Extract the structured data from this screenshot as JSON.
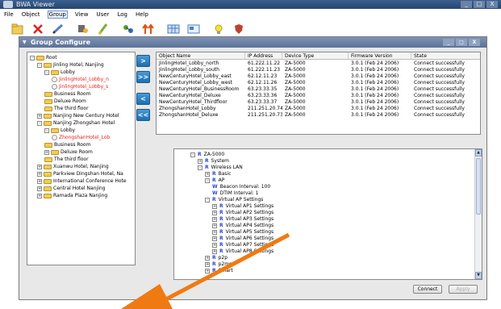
{
  "app": {
    "title": "BWA Viewer"
  },
  "window_controls": [
    "_",
    "□",
    "X"
  ],
  "menu": [
    "File",
    "Object",
    "Group",
    "View",
    "User",
    "Log",
    "Help"
  ],
  "menu_selected": "Group",
  "toolbar_icons": [
    "open-icon",
    "delete-icon",
    "edit-icon",
    "config-icon",
    "pen-icon",
    "link-icon",
    "upgrade-icon",
    "table-icon",
    "terminal-icon",
    "bulb-icon",
    "shield-icon"
  ],
  "panel": {
    "title": "Group Configure",
    "controls": [
      "_",
      "□",
      "X"
    ]
  },
  "left_tree": [
    {
      "label": "Root",
      "level": 0,
      "type": "folder",
      "expander": "-",
      "red": false
    },
    {
      "label": "Jinling Hotel, Nanjing",
      "level": 1,
      "type": "folder",
      "expander": "-",
      "red": false
    },
    {
      "label": "Lobby",
      "level": 2,
      "type": "folder",
      "expander": "-",
      "red": false
    },
    {
      "label": "JinlingHotel_Lobby_n",
      "level": 3,
      "type": "device",
      "expander": "",
      "red": true
    },
    {
      "label": "JinlingHotel_Lobby_s",
      "level": 3,
      "type": "device",
      "expander": "",
      "red": true
    },
    {
      "label": "Business Room",
      "level": 2,
      "type": "folder",
      "expander": "",
      "red": false
    },
    {
      "label": "Deluxe Room",
      "level": 2,
      "type": "folder",
      "expander": "",
      "red": false
    },
    {
      "label": "The third floor",
      "level": 2,
      "type": "folder",
      "expander": "",
      "red": false
    },
    {
      "label": "Nanjing New Century Hotel",
      "level": 1,
      "type": "folder",
      "expander": "+",
      "red": false
    },
    {
      "label": "Nanjing Zhongshan Hotel",
      "level": 1,
      "type": "folder",
      "expander": "-",
      "red": false
    },
    {
      "label": "Lobby",
      "level": 2,
      "type": "folder",
      "expander": "-",
      "red": false
    },
    {
      "label": "ZhongshanHotel_Lob",
      "level": 3,
      "type": "device",
      "expander": "",
      "red": true
    },
    {
      "label": "Business Room",
      "level": 2,
      "type": "folder",
      "expander": "",
      "red": false
    },
    {
      "label": "Deluxe Room",
      "level": 2,
      "type": "folder",
      "expander": "+",
      "red": false
    },
    {
      "label": "The third floor",
      "level": 2,
      "type": "folder",
      "expander": "",
      "red": false
    },
    {
      "label": "Xuanwu Hotel, Nanjing",
      "level": 1,
      "type": "folder",
      "expander": "+",
      "red": false
    },
    {
      "label": "Parkview Dingshan Hotel, Na",
      "level": 1,
      "type": "folder",
      "expander": "+",
      "red": false
    },
    {
      "label": "International Conference Hote",
      "level": 1,
      "type": "folder",
      "expander": "+",
      "red": false
    },
    {
      "label": "Central Hotel Nanjing",
      "level": 1,
      "type": "folder",
      "expander": "+",
      "red": false
    },
    {
      "label": "Ramada Plaza Nanjing",
      "level": 1,
      "type": "folder",
      "expander": "+",
      "red": false
    }
  ],
  "mid_buttons": [
    ">",
    ">>",
    "<",
    "<<"
  ],
  "table": {
    "columns": [
      "Object Name",
      "IP Address",
      "Device Type",
      "Firmware Version",
      "State"
    ],
    "rows": [
      [
        "JinlingHotel_Lobby_north",
        "61.222.11.22",
        "ZA-5000",
        "3.0.1 (Feb 24 2006)",
        "Connect successfully"
      ],
      [
        "JinlingHotel_Lobby_south",
        "61.222.11.23",
        "ZA-5000",
        "3.0.1 (Feb 24 2006)",
        "Connect successfully"
      ],
      [
        "NewCenturyHotel_Lobby_east",
        "62.12.11.23",
        "ZA-5000",
        "3.0.1 (Feb 24 2006)",
        "Connect successfully"
      ],
      [
        "NewCenturyHotel_Lobby_west",
        "62.12.11.26",
        "ZA-5000",
        "3.0.1 (Feb 24 2006)",
        "Connect successfully"
      ],
      [
        "NewCenturyHotel_BusinessRoom",
        "63.23.33.35",
        "ZA-5000",
        "3.0.1 (Feb 24 2006)",
        "Connect successfully"
      ],
      [
        "NewCenturyHotel_Deluxe",
        "63.23.33.36",
        "ZA-5000",
        "3.0.1 (Feb 24 2006)",
        "Connect successfully"
      ],
      [
        "NewCenturyHotel_Thirdfloor",
        "63.23.33.37",
        "ZA-5000",
        "3.0.1 (Feb 24 2006)",
        "Connect successfully"
      ],
      [
        "ZhongshanHotel_Lobby",
        "211.251.20.74",
        "ZA-5000",
        "3.0.1 (Feb 24 2006)",
        "Connect successfully"
      ],
      [
        "ZhongshanHotel_Deluxe",
        "211.251.20.73",
        "ZA-5000",
        "3.0.1 (Feb 24 2006)",
        "Connect successfully"
      ]
    ]
  },
  "config_tree": [
    {
      "label": "ZA-5000",
      "level": 0,
      "expander": "-",
      "badge": "R"
    },
    {
      "label": "System",
      "level": 1,
      "expander": "+",
      "badge": "R"
    },
    {
      "label": "Wireless LAN",
      "level": 1,
      "expander": "-",
      "badge": "R"
    },
    {
      "label": "Basic",
      "level": 2,
      "expander": "+",
      "badge": "R"
    },
    {
      "label": "AP",
      "level": 2,
      "expander": "-",
      "badge": "R"
    },
    {
      "label": "Beacon Interval: 100",
      "level": 3,
      "expander": "",
      "badge": "W"
    },
    {
      "label": "DTIM Interval: 1",
      "level": 3,
      "expander": "",
      "badge": "W"
    },
    {
      "label": "Virtual AP Settings",
      "level": 2,
      "expander": "-",
      "badge": "R"
    },
    {
      "label": "Virtual AP1 Settings",
      "level": 3,
      "expander": "+",
      "badge": "R"
    },
    {
      "label": "Virtual AP2 Settings",
      "level": 3,
      "expander": "+",
      "badge": "R"
    },
    {
      "label": "Virtual AP3 Settings",
      "level": 3,
      "expander": "+",
      "badge": "R"
    },
    {
      "label": "Virtual AP4 Settings",
      "level": 3,
      "expander": "+",
      "badge": "R"
    },
    {
      "label": "Virtual AP5 Settings",
      "level": 3,
      "expander": "+",
      "badge": "R"
    },
    {
      "label": "Virtual AP6 Settings",
      "level": 3,
      "expander": "+",
      "badge": "R"
    },
    {
      "label": "Virtual AP7 Settings",
      "level": 3,
      "expander": "+",
      "badge": "R"
    },
    {
      "label": "Virtual AP8 Settings",
      "level": 3,
      "expander": "+",
      "badge": "R"
    },
    {
      "label": "p2p",
      "level": 2,
      "expander": "+",
      "badge": "R"
    },
    {
      "label": "p2mp",
      "level": 2,
      "expander": "+",
      "badge": "R"
    },
    {
      "label": "Smart",
      "level": 2,
      "expander": "+",
      "badge": "R"
    }
  ],
  "buttons": {
    "connect": "Connect",
    "apply": "Apply"
  },
  "colors": {
    "accent_red": "#e02020",
    "badge_blue": "#2b48c8",
    "arrow_orange": "#f07a12",
    "nav_button_blue": "#1c6fb0"
  }
}
